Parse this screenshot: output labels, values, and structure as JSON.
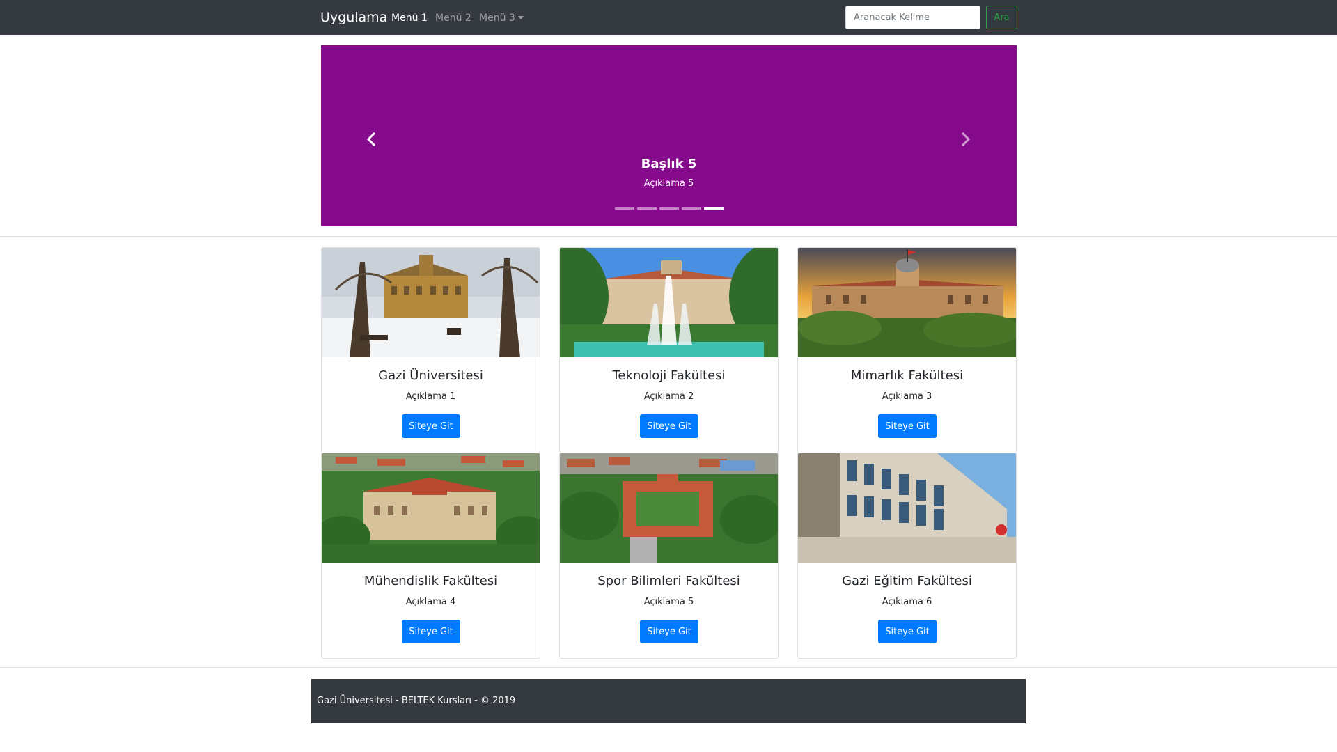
{
  "navbar": {
    "brand": "Uygulama",
    "links": [
      {
        "label": "Menü 1",
        "active": true
      },
      {
        "label": "Menü 2",
        "active": false
      },
      {
        "label": "Menü 3",
        "active": false,
        "dropdown": true
      }
    ],
    "search": {
      "placeholder": "Aranacak Kelime",
      "value": "",
      "button_label": "Ara"
    }
  },
  "carousel": {
    "background": "#860a8c",
    "title": "Başlık 5",
    "text": "Açıklama 5",
    "slide_count": 5,
    "active_index": 4
  },
  "cards": [
    {
      "title": "Gazi Üniversitesi",
      "text": "Açıklama 1",
      "button": "Siteye Git",
      "image": "campus-snow-photo"
    },
    {
      "title": "Teknoloji Fakültesi",
      "text": "Açıklama 2",
      "button": "Siteye Git",
      "image": "fountain-building-photo"
    },
    {
      "title": "Mimarlık Fakültesi",
      "text": "Açıklama 3",
      "button": "Siteye Git",
      "image": "sunset-building-photo"
    },
    {
      "title": "Mühendislik Fakültesi",
      "text": "Açıklama 4",
      "button": "Siteye Git",
      "image": "aerial-campus-photo"
    },
    {
      "title": "Spor Bilimleri Fakültesi",
      "text": "Açıklama 5",
      "button": "Siteye Git",
      "image": "aerial-campus-photo-2"
    },
    {
      "title": "Gazi Eğitim Fakültesi",
      "text": "Açıklama 6",
      "button": "Siteye Git",
      "image": "modern-building-photo"
    }
  ],
  "footer": {
    "text": "Gazi Üniversitesi - BELTEK Kursları - © 2019"
  },
  "colors": {
    "navbar": "#343a40",
    "primary": "#007bff",
    "success": "#28a745",
    "carousel": "#860a8c"
  }
}
